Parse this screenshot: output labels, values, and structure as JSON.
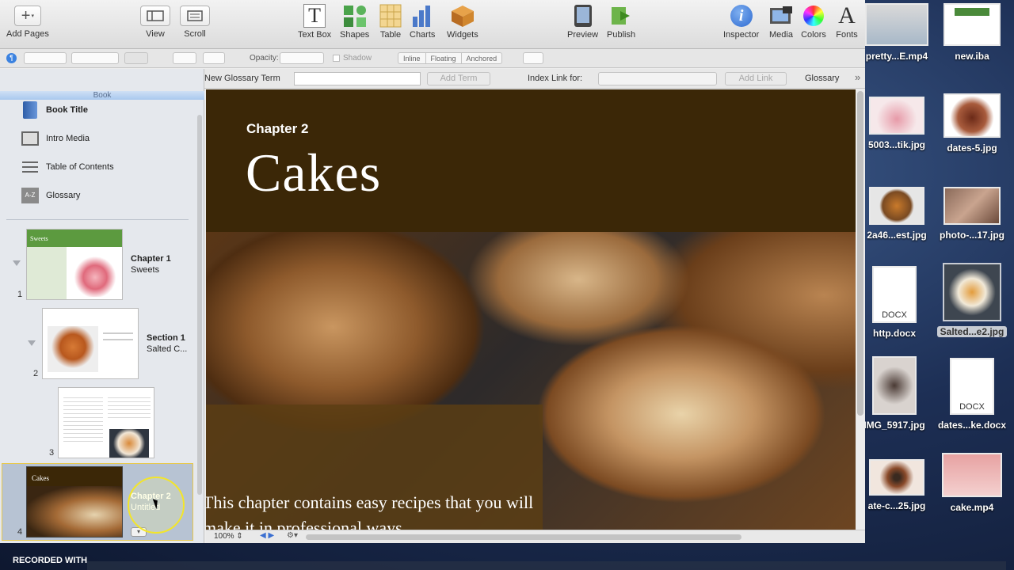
{
  "toolbar": {
    "add_pages": "Add Pages",
    "view": "View",
    "scroll": "Scroll",
    "text_box": "Text Box",
    "shapes": "Shapes",
    "table": "Table",
    "charts": "Charts",
    "widgets": "Widgets",
    "preview": "Preview",
    "publish": "Publish",
    "inspector": "Inspector",
    "media": "Media",
    "colors": "Colors",
    "fonts": "Fonts"
  },
  "formatbar": {
    "opacity_label": "Opacity:",
    "shadow_label": "Shadow",
    "inline": "Inline",
    "floating": "Floating",
    "anchored": "Anchored"
  },
  "glossary_bar": {
    "new_term_label": "New Glossary Term",
    "add_term": "Add Term",
    "index_link_label": "Index Link for:",
    "add_link": "Add Link",
    "glossary": "Glossary"
  },
  "sidebar": {
    "header": "Book",
    "items": [
      {
        "label": "Book Title",
        "icon": "book-icon"
      },
      {
        "label": "Intro Media",
        "icon": "film-icon"
      },
      {
        "label": "Table of Contents",
        "icon": "list-icon"
      },
      {
        "label": "Glossary",
        "icon": "a-z-icon"
      }
    ],
    "pages": [
      {
        "num": "1",
        "title": "Chapter 1",
        "subtitle": "Sweets",
        "thumb_title": "Sweets"
      },
      {
        "num": "2",
        "title": "Section 1",
        "subtitle": "Salted C..."
      },
      {
        "num": "3"
      },
      {
        "num": "4",
        "title": "Chapter 2",
        "subtitle": "Untitled",
        "thumb_title": "Cakes"
      }
    ]
  },
  "canvas": {
    "chapter_label": "Chapter 2",
    "chapter_title": "Cakes",
    "body_text": "This chapter contains easy recipes that you will make it in professional ways."
  },
  "statusbar": {
    "zoom": "100%"
  },
  "desktop_icons": [
    {
      "name": "pretty...E.mp4",
      "selected": false
    },
    {
      "name": "new.iba",
      "selected": false
    },
    {
      "name": "5003...tik.jpg",
      "selected": false
    },
    {
      "name": "dates-5.jpg",
      "selected": false
    },
    {
      "name": "2a46...est.jpg",
      "selected": false
    },
    {
      "name": "photo-...17.jpg",
      "selected": false
    },
    {
      "name": "http.docx",
      "selected": false,
      "badge": "DOCX"
    },
    {
      "name": "Salted...e2.jpg",
      "selected": true
    },
    {
      "name": "IMG_5917.jpg",
      "selected": false
    },
    {
      "name": "dates...ke.docx",
      "selected": false,
      "badge": "DOCX"
    },
    {
      "name": "ate-c...25.jpg",
      "selected": false
    },
    {
      "name": "cake.mp4",
      "selected": false
    }
  ],
  "recording_label": "RECORDED WITH"
}
